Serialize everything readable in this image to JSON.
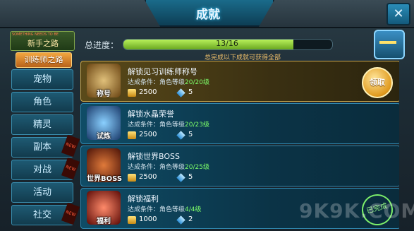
{
  "header": {
    "title": "成就",
    "close_label": "✕"
  },
  "sidebar": {
    "banner_small": "SOMETHING NEEDS TO BE",
    "banner_text": "新手之路",
    "guide_label": "训练师之路",
    "items": [
      {
        "label": "宠物",
        "new": false
      },
      {
        "label": "角色",
        "new": false
      },
      {
        "label": "精灵",
        "new": false
      },
      {
        "label": "副本",
        "new": true
      },
      {
        "label": "对战",
        "new": true
      },
      {
        "label": "活动",
        "new": false
      },
      {
        "label": "社交",
        "new": true
      }
    ],
    "new_tag": "NEW"
  },
  "progress": {
    "label": "总进度：",
    "text": "13/16",
    "fraction": 0.8125,
    "hint": "总完成以下成就可获得全部"
  },
  "achievements": [
    {
      "icon_label": "称号",
      "title": "解锁见习训练师称号",
      "cond_prefix": "达成条件：角色等级",
      "cond_value": "20/20级",
      "gold": "2500",
      "gems": "5",
      "state": "claim",
      "claim_label": "领取",
      "icon_color": "#9a6a2a"
    },
    {
      "icon_label": "试炼",
      "title": "解锁水晶荣誉",
      "cond_prefix": "达成条件：角色等级",
      "cond_value": "20/23级",
      "gold": "2500",
      "gems": "5",
      "state": "none",
      "icon_color": "#2a6ab0"
    },
    {
      "icon_label": "世界BOSS",
      "title": "解锁世界BOSS",
      "cond_prefix": "达成条件：角色等级",
      "cond_value": "20/25级",
      "gold": "2500",
      "gems": "5",
      "state": "none",
      "icon_color": "#a03a1a"
    },
    {
      "icon_label": "福利",
      "title": "解锁福利",
      "cond_prefix": "达成条件：角色等级",
      "cond_value": "4/4级",
      "gold": "1000",
      "gems": "2",
      "state": "done",
      "done_label": "已完成",
      "icon_color": "#b03020"
    }
  ],
  "watermark": "9K9K.COM"
}
